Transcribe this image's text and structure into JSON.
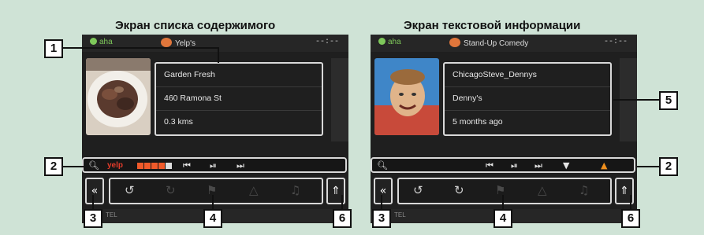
{
  "left_screen": {
    "heading": "Экран списка содержимого",
    "source": "aha",
    "station": "Yelp's",
    "time": "--:--",
    "info_rows": [
      "Garden Fresh",
      "460 Ramona St",
      "0.3 kms"
    ],
    "control_icons": [
      "search-icon",
      "yelp-logo",
      "rating-stars",
      "prev-track-icon",
      "play-pause-icon",
      "next-track-icon"
    ],
    "rating_stars": 4,
    "rating_max": 5,
    "eq_label": "TEL"
  },
  "right_screen": {
    "heading": "Экран текстовой информации",
    "source": "aha",
    "station": "Stand-Up Comedy",
    "time": "--:--",
    "info_rows": [
      "ChicagoSteve_Dennys",
      "Denny's",
      "5 months ago"
    ],
    "control_icons": [
      "search-icon",
      "prev-track-icon",
      "play-pause-icon",
      "next-track-icon",
      "thumbs-down-icon",
      "thumbs-up-icon"
    ],
    "eq_label": "TEL"
  },
  "function_icons": [
    "replay-15-icon",
    "forward-30-icon",
    "map-icon",
    "navigate-icon",
    "microphone-icon"
  ],
  "nav_glyphs": {
    "open": "«",
    "upload": "⇑"
  },
  "callouts": [
    "1",
    "2",
    "3",
    "4",
    "5",
    "6"
  ],
  "colors": {
    "background": "#cfe3d6",
    "screen": "#1f1f1f",
    "frame": "#d8d8d8",
    "aha_green": "#7ec85a",
    "thumbs_up": "#f0901e"
  }
}
